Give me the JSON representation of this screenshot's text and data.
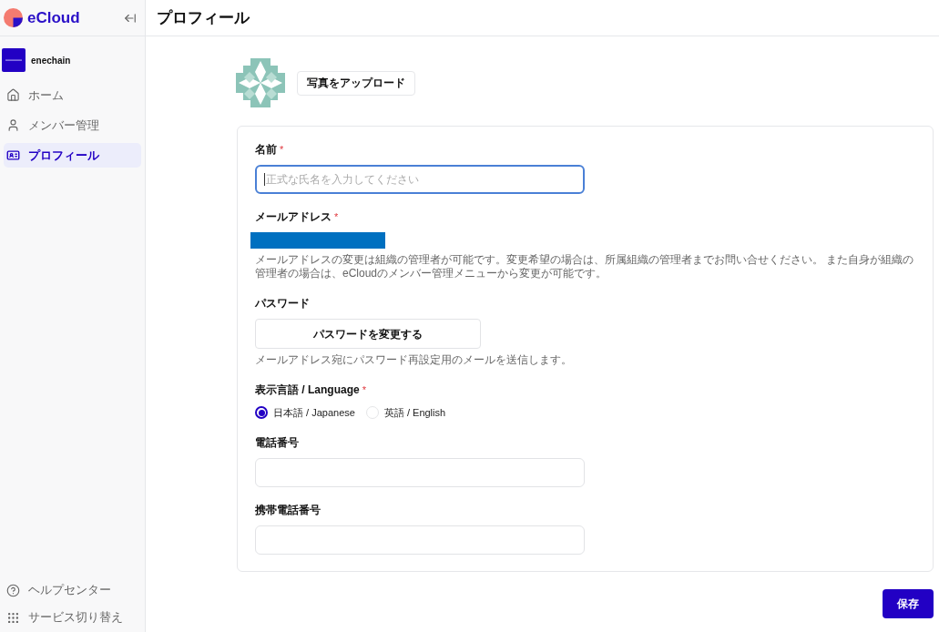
{
  "sidebar": {
    "logo": {
      "text": "eCloud"
    },
    "organization": {
      "name": "enechain"
    },
    "nav_items": [
      {
        "label": "ホーム",
        "selected": false
      },
      {
        "label": "メンバー管理",
        "selected": false
      },
      {
        "label": "プロフィール",
        "selected": true
      }
    ],
    "footer_items": [
      {
        "label": "ヘルプセンター"
      },
      {
        "label": "サービス切り替え"
      }
    ]
  },
  "header": {
    "title": "プロフィール"
  },
  "avatar_section": {
    "upload_button": "写真をアップロード"
  },
  "form": {
    "fields": [
      {
        "kind": "text",
        "label": "名前",
        "required_mark": "*",
        "placeholder": "正式な氏名を入力してください",
        "focused": true
      },
      {
        "kind": "redacted",
        "label": "メールアドレス",
        "required_mark": "*",
        "help": "メールアドレスの変更は組織の管理者が可能です。変更希望の場合は、所属組織の管理者までお問い合せください。 また自身が組織の管理者の場合は、eCloudのメンバー管理メニューから変更が可能です。"
      },
      {
        "kind": "action",
        "label": "パスワード",
        "button": "パスワードを変更する",
        "help": "メールアドレス宛にパスワード再設定用のメールを送信します。"
      },
      {
        "kind": "radio",
        "label": "表示言語 / Language",
        "required_mark": "*",
        "options": [
          {
            "label": "日本語 / Japanese",
            "selected": true
          },
          {
            "label": "英語 / English",
            "selected": false
          }
        ]
      },
      {
        "kind": "text",
        "label": "電話番号",
        "focused": false
      },
      {
        "kind": "text",
        "label": "携帯電話番号",
        "focused": false
      }
    ]
  },
  "save_button": "保存"
}
